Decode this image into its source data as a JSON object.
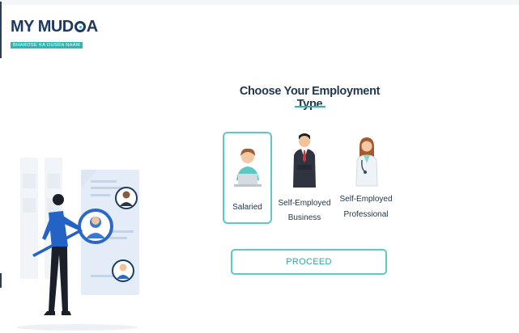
{
  "brand": {
    "name_part1": "MY MUD",
    "name_part2": "A",
    "tagline": "BHAROSE KA DUSRA NAAM"
  },
  "main": {
    "title": "Choose Your Employment Type",
    "options": [
      {
        "label_line1": "Salaried",
        "label_line2": "",
        "selected": true,
        "icon": "salaried-person-icon"
      },
      {
        "label_line1": "Self-Employed",
        "label_line2": "Business",
        "selected": false,
        "icon": "business-person-icon"
      },
      {
        "label_line1": "Self-Employed",
        "label_line2": "Professional",
        "selected": false,
        "icon": "professional-person-icon"
      }
    ],
    "proceed_label": "PROCEED"
  },
  "colors": {
    "brand_navy": "#1f3a60",
    "accent_teal": "#2cb7b0",
    "heading": "#21384f"
  }
}
